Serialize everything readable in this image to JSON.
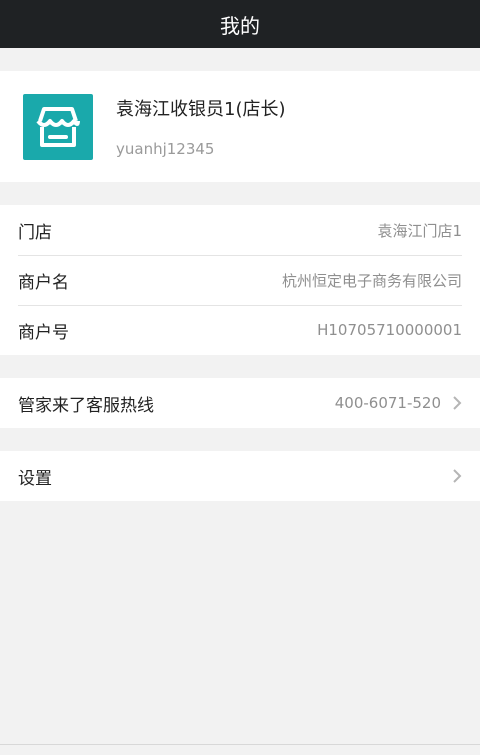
{
  "header": {
    "title": "我的"
  },
  "profile": {
    "name": "袁海江收银员1(店长)",
    "user_id": "yuanhj12345",
    "avatar_icon": "store-icon",
    "avatar_color": "#1aa9ab"
  },
  "info": {
    "store": {
      "label": "门店",
      "value": "袁海江门店1"
    },
    "merchant_name": {
      "label": "商户名",
      "value": "杭州恒定电子商务有限公司"
    },
    "merchant_id": {
      "label": "商户号",
      "value": "H10705710000001"
    }
  },
  "hotline": {
    "label": "管家来了客服热线",
    "value": "400-6071-520",
    "icon": "chevron-right-icon"
  },
  "settings": {
    "label": "设置",
    "icon": "chevron-right-icon"
  }
}
